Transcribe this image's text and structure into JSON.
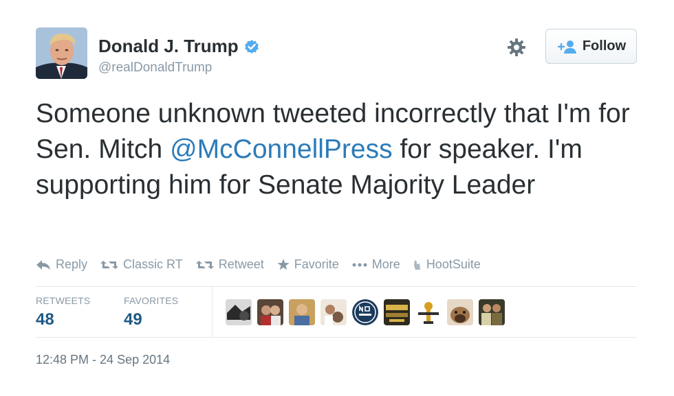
{
  "author": {
    "display_name": "Donald J. Trump",
    "handle": "@realDonaldTrump",
    "verified": true
  },
  "header": {
    "follow_label": "Follow",
    "settings_icon": "gear-icon"
  },
  "tweet": {
    "text_before": "Someone unknown tweeted incorrectly that I'm for Sen. Mitch ",
    "mention": "@McConnellPress",
    "text_after": " for speaker. I'm supporting him for Senate Majority Leader"
  },
  "actions": [
    {
      "label": "Reply",
      "icon": "reply-icon"
    },
    {
      "label": "Classic RT",
      "icon": "retweet-icon"
    },
    {
      "label": "Retweet",
      "icon": "retweet-icon"
    },
    {
      "label": "Favorite",
      "icon": "star-icon"
    },
    {
      "label": "More",
      "icon": "more-dots-icon"
    },
    {
      "label": "HootSuite",
      "icon": "hootsuite-icon"
    }
  ],
  "stats": {
    "retweets_label": "RETWEETS",
    "retweets_count": "48",
    "favorites_label": "FAVORITES",
    "favorites_count": "49"
  },
  "timestamp": "12:48 PM - 24 Sep 2014",
  "colors": {
    "link": "#2b7bb9",
    "muted": "#8899a6",
    "count": "#1e5a85",
    "verified": "#55acee"
  }
}
